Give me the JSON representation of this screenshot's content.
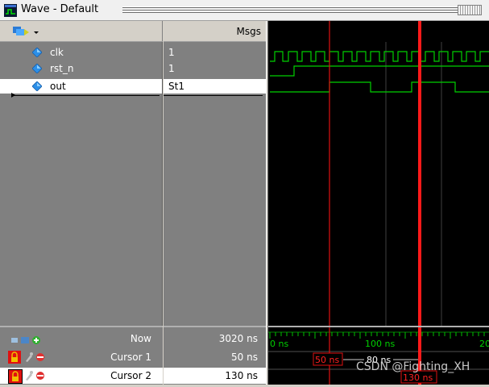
{
  "window": {
    "title": "Wave - Default"
  },
  "header": {
    "values_title": "Msgs"
  },
  "signals": [
    {
      "name": "clk",
      "value": "1",
      "icon": "signal-diamond-icon",
      "selected": false
    },
    {
      "name": "rst_n",
      "value": "1",
      "icon": "signal-diamond-icon",
      "selected": false
    },
    {
      "name": "out",
      "value": "St1",
      "icon": "signal-diamond-icon",
      "selected": true
    }
  ],
  "cursors_panel": {
    "now_label": "Now",
    "now_value": "3020 ns",
    "cursors": [
      {
        "label": "Cursor 1",
        "value": "50 ns",
        "locked": true,
        "selected": false
      },
      {
        "label": "Cursor 2",
        "value": "130 ns",
        "locked": true,
        "selected": true
      }
    ]
  },
  "timeline": {
    "tick_labels": [
      "0 ns",
      "100 ns",
      "200"
    ],
    "cursor1_label": "50 ns",
    "cursor2_label": "130 ns",
    "delta_label": "80 ns"
  },
  "colors": {
    "wave": "#00d000",
    "cursor": "#ff1a1a",
    "cursor_label": "#ff2020",
    "ruler": "#00c000"
  },
  "watermark": "CSDN @Fighting_XH"
}
